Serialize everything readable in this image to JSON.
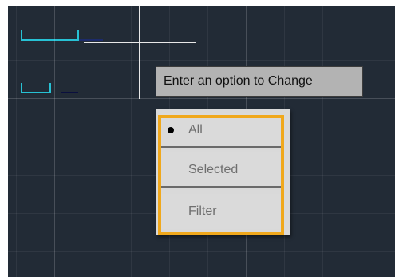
{
  "tooltip": {
    "text": "Enter an option to Change"
  },
  "menu": {
    "items": [
      {
        "label": "All",
        "selected": true
      },
      {
        "label": "Selected",
        "selected": false
      },
      {
        "label": "Filter",
        "selected": false
      }
    ]
  },
  "colors": {
    "canvas_background": "#222b36",
    "cyan_geometry": "#27c1d4",
    "crosshair": "#e8e8e8",
    "highlight_outline": "#f0a81c",
    "menu_background": "#d9d9d9",
    "tooltip_background": "#b3b3b3"
  },
  "icons": {
    "selected_marker": "bullet-icon",
    "cursor": "crosshair-cursor-icon"
  }
}
